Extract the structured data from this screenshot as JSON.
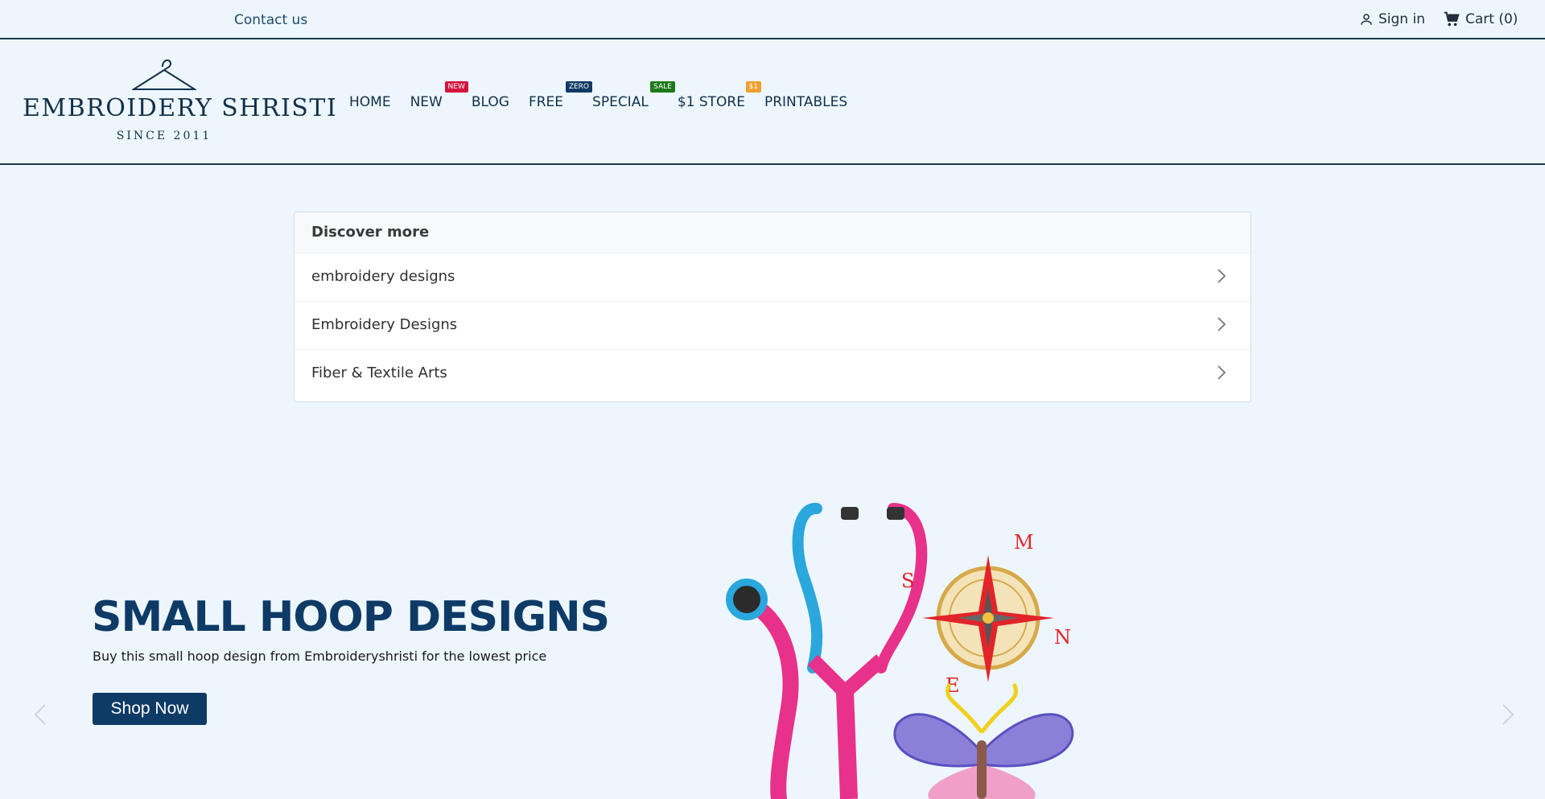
{
  "topbar": {
    "contact": "Contact us",
    "signin": "Sign in",
    "cart": "Cart (0)"
  },
  "logo": {
    "title": "EMBROIDERY SHRISTI",
    "subtitle": "SINCE 2011"
  },
  "nav": [
    {
      "label": "HOME"
    },
    {
      "label": "NEW",
      "badge": "NEW",
      "badge_color": "#d6133f"
    },
    {
      "label": "BLOG"
    },
    {
      "label": "FREE",
      "badge": "ZERO",
      "badge_color": "#0e3a66"
    },
    {
      "label": "SPECIAL",
      "badge": "SALE",
      "badge_color": "#1d7a1d"
    },
    {
      "label": "$1 STORE",
      "badge": "$1",
      "badge_color": "#f0a030"
    },
    {
      "label": "PRINTABLES"
    }
  ],
  "discover": {
    "heading": "Discover more",
    "items": [
      "embroidery designs",
      "Embroidery Designs",
      "Fiber & Textile Arts"
    ]
  },
  "hero": {
    "title": "SMALL HOOP DESIGNS",
    "subtitle": "Buy this small hoop design from Embroideryshristi for the lowest price",
    "button": "Shop Now"
  },
  "icons": {
    "user": "user-icon",
    "cart": "cart-icon",
    "prev": "chevron-left-icon",
    "next": "chevron-right-icon"
  }
}
